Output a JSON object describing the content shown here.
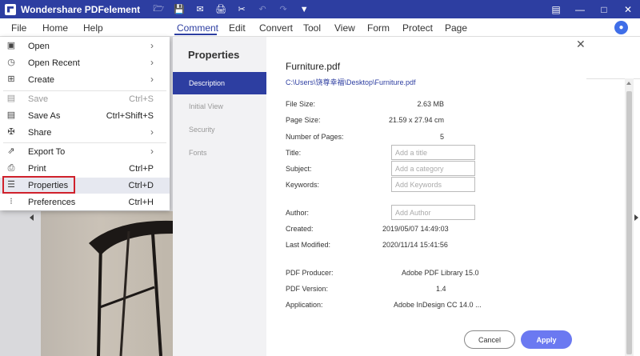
{
  "window": {
    "app_title": "Wondershare PDFelement"
  },
  "menubar": {
    "left": [
      "File",
      "Home",
      "Help"
    ],
    "tabs": [
      "Comment",
      "Edit",
      "Convert",
      "Tool",
      "View",
      "Form",
      "Protect",
      "Page"
    ],
    "active_tab": "Comment"
  },
  "file_menu": {
    "items": [
      {
        "label": "Open",
        "shortcut": "",
        "submenu": true,
        "icon": "folder-open-icon"
      },
      {
        "label": "Open Recent",
        "shortcut": "",
        "submenu": true,
        "icon": "clock-icon"
      },
      {
        "label": "Create",
        "shortcut": "",
        "submenu": true,
        "icon": "create-icon"
      },
      {
        "label": "Save",
        "shortcut": "Ctrl+S",
        "submenu": false,
        "icon": "save-icon",
        "disabled": true
      },
      {
        "label": "Save As",
        "shortcut": "Ctrl+Shift+S",
        "submenu": false,
        "icon": "save-as-icon"
      },
      {
        "label": "Share",
        "shortcut": "",
        "submenu": true,
        "icon": "share-icon"
      },
      {
        "label": "Export To",
        "shortcut": "",
        "submenu": true,
        "icon": "export-icon"
      },
      {
        "label": "Print",
        "shortcut": "Ctrl+P",
        "submenu": false,
        "icon": "print-icon"
      },
      {
        "label": "Properties",
        "shortcut": "Ctrl+D",
        "submenu": false,
        "icon": "properties-icon",
        "highlighted": true
      },
      {
        "label": "Preferences",
        "shortcut": "Ctrl+H",
        "submenu": false,
        "icon": "preferences-icon"
      }
    ]
  },
  "properties": {
    "title": "Properties",
    "nav": [
      "Description",
      "Initial View",
      "Security",
      "Fonts"
    ],
    "active_nav": "Description",
    "file_name": "Furniture.pdf",
    "file_path": "C:\\Users\\饶尊幸福\\Desktop\\Furniture.pdf",
    "labels": {
      "file_size": "File Size:",
      "page_size": "Page Size:",
      "num_pages": "Number of Pages:",
      "title": "Title:",
      "subject": "Subject:",
      "keywords": "Keywords:",
      "author": "Author:",
      "created": "Created:",
      "modified": "Last Modified:",
      "producer": "PDF Producer:",
      "version": "PDF Version:",
      "application": "Application:"
    },
    "values": {
      "file_size": "2.63 MB",
      "page_size": "21.59 x 27.94 cm",
      "num_pages": "5",
      "created": "2019/05/07 14:49:03",
      "modified": "2020/11/14 15:41:56",
      "producer": "Adobe PDF Library 15.0",
      "version": "1.4",
      "application": "Adobe InDesign CC 14.0 ..."
    },
    "placeholders": {
      "title": "Add a title",
      "subject": "Add a category",
      "keywords": "Add Keywords",
      "author": "Add Author"
    },
    "buttons": {
      "cancel": "Cancel",
      "apply": "Apply"
    }
  },
  "colors": {
    "brand": "#2d3ea1",
    "apply_button": "#6b79f1",
    "highlight_box": "#d0212c"
  }
}
